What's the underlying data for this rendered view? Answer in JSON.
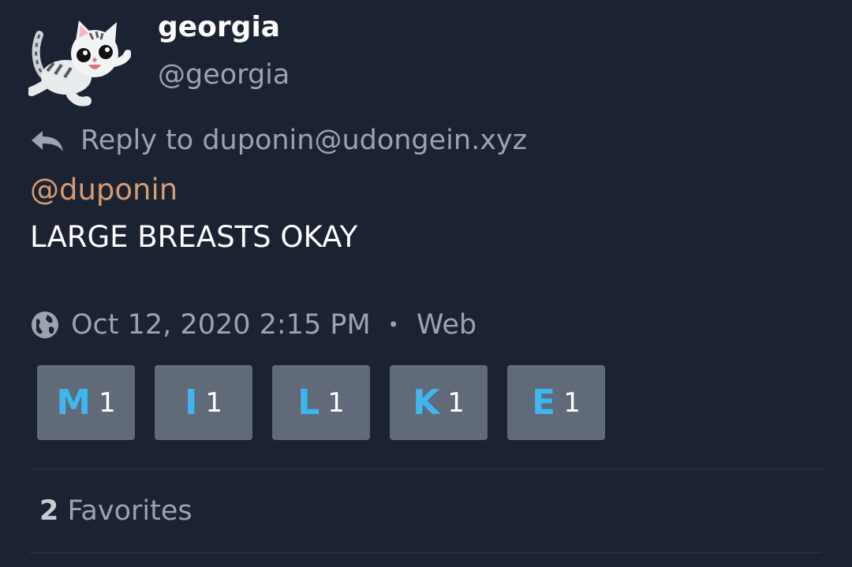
{
  "author": {
    "display_name": "georgia",
    "handle": "@georgia",
    "avatar": "cat-avatar"
  },
  "reply": {
    "icon": "reply-icon",
    "text": "Reply to duponin@udongein.xyz"
  },
  "status": {
    "mention": "@duponin",
    "text": "LARGE BREASTS OKAY"
  },
  "meta": {
    "visibility_icon": "globe-icon",
    "timestamp": "Oct 12, 2020 2:15 PM",
    "separator": "•",
    "application": "Web"
  },
  "reactions": [
    {
      "emoji": "M",
      "count": "1"
    },
    {
      "emoji": "I",
      "count": "1"
    },
    {
      "emoji": "L",
      "count": "1"
    },
    {
      "emoji": "K",
      "count": "1"
    },
    {
      "emoji": "E",
      "count": "1"
    }
  ],
  "favorites": {
    "count": "2",
    "label": "Favorites"
  },
  "colors": {
    "background": "#1b2231",
    "mention": "#d59b71",
    "reaction_bg": "#616a78",
    "reaction_letter": "#3fb6ee",
    "muted_text": "#9ba3af"
  }
}
